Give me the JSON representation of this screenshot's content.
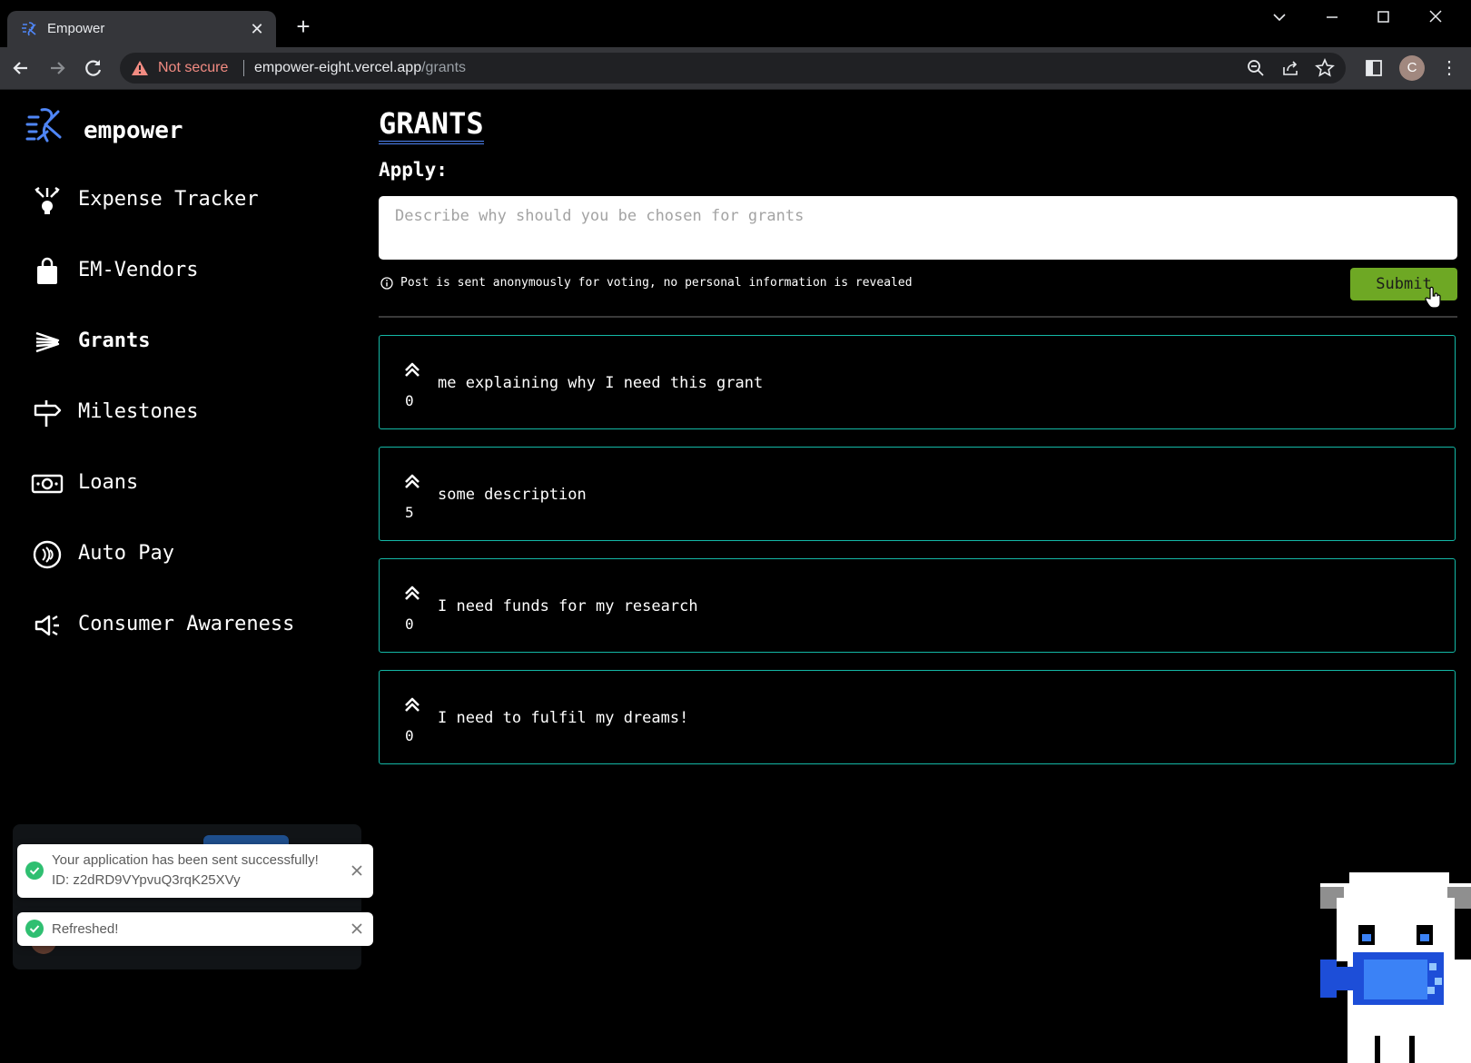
{
  "browser": {
    "tab_title": "Empower",
    "new_tab_symbol": "+",
    "security_label": "Not secure",
    "url_host": "empower-eight.vercel.app",
    "url_path": "/grants",
    "profile_initial": "C"
  },
  "sidebar": {
    "brand": "empower",
    "items": [
      {
        "label": "Expense Tracker",
        "icon": "expense-icon"
      },
      {
        "label": "EM-Vendors",
        "icon": "shopping-bag-icon"
      },
      {
        "label": "Grants",
        "icon": "grants-icon"
      },
      {
        "label": "Milestones",
        "icon": "signpost-icon"
      },
      {
        "label": "Loans",
        "icon": "money-icon"
      },
      {
        "label": "Auto Pay",
        "icon": "autopay-icon"
      },
      {
        "label": "Consumer Awareness",
        "icon": "megaphone-icon"
      }
    ],
    "active_item": "Grants"
  },
  "main": {
    "title": "GRANTS",
    "apply_label": "Apply:",
    "input_placeholder": "Describe why should you be chosen for grants",
    "info_text": "Post is sent anonymously for voting, no personal information is revealed",
    "submit_label": "Submit",
    "posts": [
      {
        "votes": "0",
        "text": "me explaining why I need this grant"
      },
      {
        "votes": "5",
        "text": "some description"
      },
      {
        "votes": "0",
        "text": "I need funds for my research"
      },
      {
        "votes": "0",
        "text": "I need to fulfil my dreams!"
      }
    ]
  },
  "toasts": [
    {
      "line1": "Your application has been sent successfully!",
      "line2": "ID: z2dRD9VYpvuQ3rqK25XVy"
    },
    {
      "line1": "Refreshed!"
    }
  ],
  "colors": {
    "accent_teal": "#14b8a6",
    "submit_green": "#6ea824",
    "logo_blue": "#4f86f7",
    "success_green": "#2fbf71"
  }
}
